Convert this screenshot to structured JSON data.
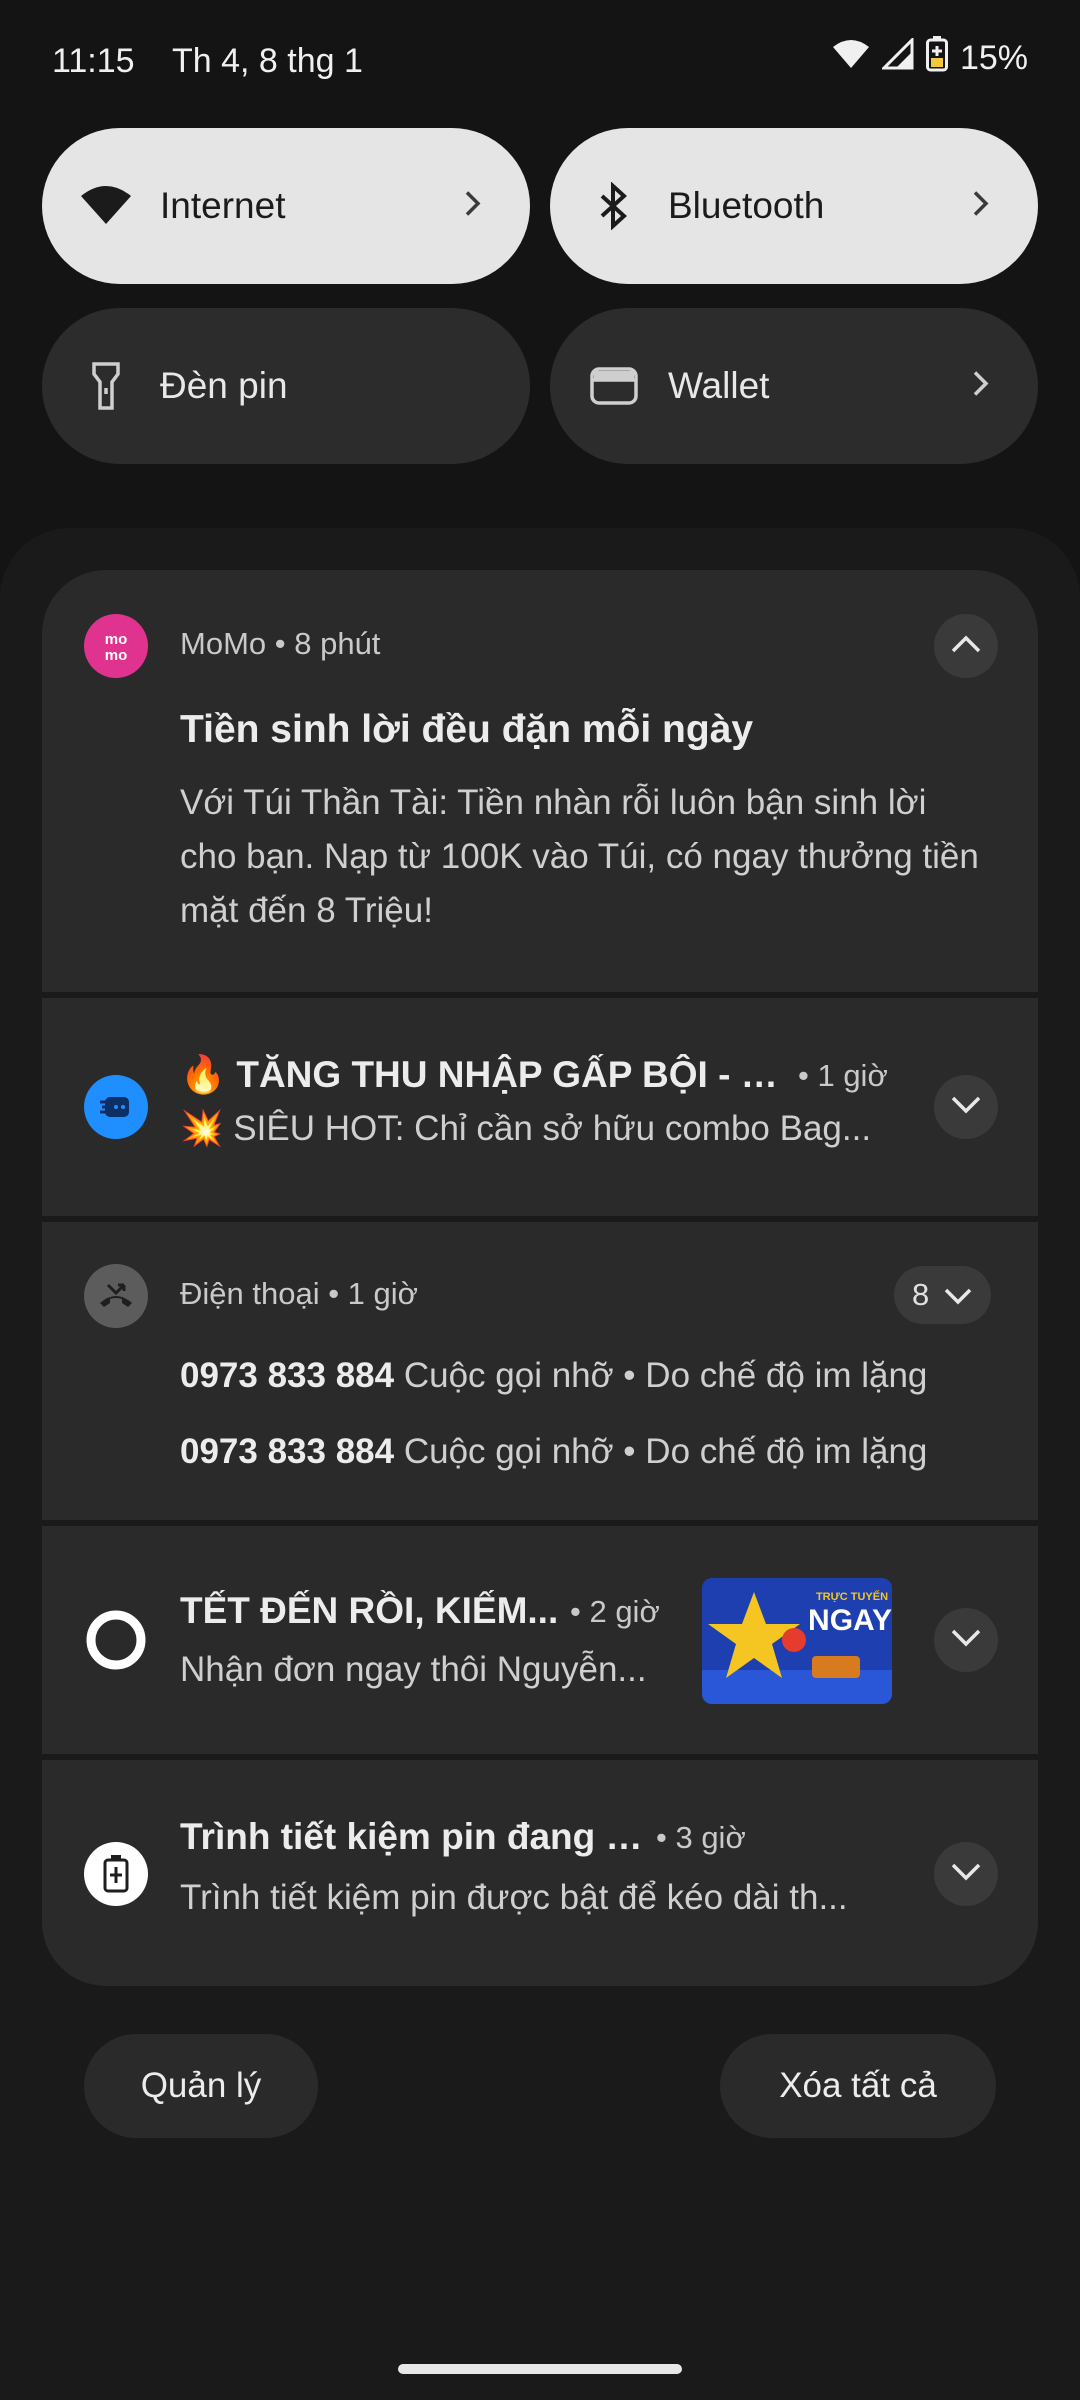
{
  "status_bar": {
    "time": "11:15",
    "date": "Th 4, 8 thg 1",
    "battery_percent": "15%"
  },
  "quick_tiles": [
    {
      "label": "Internet",
      "icon": "wifi-icon",
      "active": true
    },
    {
      "label": "Bluetooth",
      "icon": "bluetooth-icon",
      "active": true
    },
    {
      "label": "Đèn pin",
      "icon": "flashlight-icon",
      "active": false
    },
    {
      "label": "Wallet",
      "icon": "wallet-icon",
      "active": false
    }
  ],
  "notifications": {
    "momo": {
      "app": "MoMo",
      "time": "• 8 phút",
      "title": "Tiền sinh lời đều đặn mỗi ngày",
      "body": "Với Túi Thần Tài: Tiền nhàn rỗi luôn bận sinh lời cho bạn. Nạp từ 100K vào Túi, có ngay thưởng tiền mặt đến 8 Triệu!"
    },
    "promo": {
      "title": "🔥 TĂNG THU NHẬP GẤP BỘI - RI...",
      "time": "• 1 giờ",
      "body": "💥 SIÊU HOT: Chỉ cần sở hữu combo Bag..."
    },
    "phone": {
      "app": "Điện thoại",
      "time": "• 1 giờ",
      "count": "8",
      "calls": [
        {
          "number": "0973 833 884",
          "detail": "Cuộc gọi nhỡ • Do chế độ im lặng"
        },
        {
          "number": "0973 833 884",
          "detail": "Cuộc gọi nhỡ • Do chế độ im lặng"
        }
      ]
    },
    "tet": {
      "title": "TẾT ĐẾN RỒI, KIẾM...",
      "time": "• 2 giờ",
      "body": "Nhận đơn ngay thôi Nguyễn...",
      "thumb_text_top": "TRỰC TUYẾN",
      "thumb_text_main": "NGAY"
    },
    "battery": {
      "title": "Trình tiết kiệm pin đang bật",
      "time": "• 3 giờ",
      "body": "Trình tiết kiệm pin được bật để kéo dài th..."
    }
  },
  "actions": {
    "manage": "Quản lý",
    "clear_all": "Xóa tất cả"
  },
  "colors": {
    "momo": "#e0338f",
    "promo_app": "#1f8fff",
    "tile_on": "#e5e5e5",
    "tile_off": "#2c2c2c",
    "card": "#2a2a2a"
  }
}
